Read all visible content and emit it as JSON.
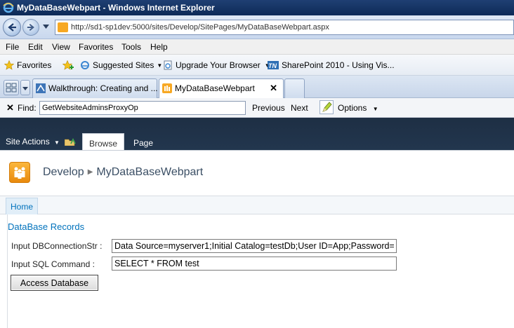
{
  "window": {
    "title": "MyDataBaseWebpart - Windows Internet Explorer"
  },
  "address": {
    "url": "http://sd1-sp1dev:5000/sites/Develop/SitePages/MyDataBaseWebpart.aspx"
  },
  "menu": {
    "items": [
      "File",
      "Edit",
      "View",
      "Favorites",
      "Tools",
      "Help"
    ]
  },
  "favorites": {
    "favorites_label": "Favorites",
    "suggested_sites": "Suggested Sites",
    "upgrade_browser": "Upgrade Your Browser",
    "sharepoint_link": "SharePoint 2010 - Using Vis..."
  },
  "tabs": [
    {
      "label": "Walkthrough: Creating and ..."
    },
    {
      "label": "MyDataBaseWebpart",
      "active": true
    }
  ],
  "find": {
    "label": "Find:",
    "value": "GetWebsiteAdminsProxyOp",
    "previous": "Previous",
    "next": "Next",
    "options": "Options"
  },
  "ribbon": {
    "site_actions": "Site Actions",
    "tab_browse": "Browse",
    "tab_page": "Page"
  },
  "site": {
    "breadcrumb_site": "Develop",
    "breadcrumb_page": "MyDataBaseWebpart"
  },
  "topnav": {
    "home": "Home"
  },
  "webpart": {
    "title": "DataBase Records",
    "conn_label": "Input DBConnectionStr :",
    "conn_value": "Data Source=myserver1;Initial Catalog=testDb;User ID=App;Password=",
    "sql_label": "Input SQL Command  :",
    "sql_value": "SELECT * FROM test",
    "button": "Access Database"
  },
  "colors": {
    "titlebar": "#0d2a57",
    "ribbon": "#1e2f44",
    "link_blue": "#0072bc",
    "site_logo": "#f7a823"
  }
}
